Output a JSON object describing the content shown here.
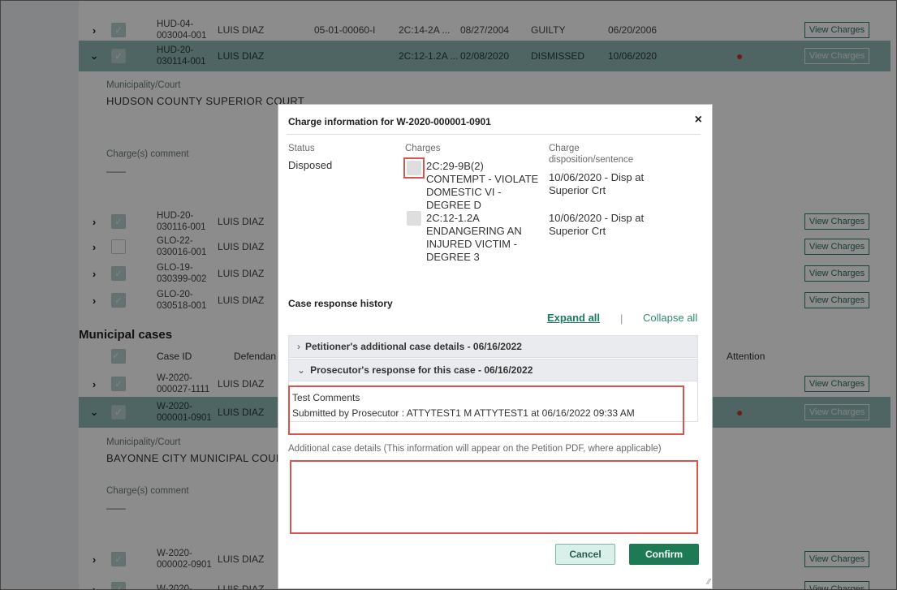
{
  "superior_rows": [
    {
      "expanded": false,
      "case_id": "HUD-04-003004-001",
      "defendant": "LUIS DIAZ",
      "col3": "05-01-00060-I",
      "charges": "2C:14-2A ...",
      "date": "08/27/2004",
      "disposition": "GUILTY",
      "disp_date": "06/20/2006",
      "view": "View Charges"
    },
    {
      "expanded": true,
      "case_id": "HUD-20-030114-001",
      "defendant": "LUIS DIAZ",
      "col3": "",
      "charges": "2C:12-1.2A ...",
      "date": "02/08/2020",
      "disposition": "DISMISSED",
      "disp_date": "10/06/2020",
      "view": "View Charges"
    },
    {
      "expanded": false,
      "case_id": "HUD-20-030116-001",
      "defendant": "LUIS DIAZ",
      "view": "View Charges"
    },
    {
      "expanded": false,
      "case_id": "GLO-22-030016-001",
      "defendant": "LUIS DIAZ",
      "view": "View Charges"
    },
    {
      "expanded": false,
      "case_id": "GLO-19-030399-002",
      "defendant": "LUIS DIAZ",
      "view": "View Charges"
    },
    {
      "expanded": false,
      "case_id": "GLO-20-030518-001",
      "defendant": "LUIS DIAZ",
      "view": "View Charges"
    }
  ],
  "superior_detail": {
    "court_label": "Municipality/Court",
    "court_value": "HUDSON COUNTY SUPERIOR COURT",
    "comment_label": "Charge(s) comment",
    "comment_value": "——"
  },
  "municipal": {
    "title": "Municipal cases",
    "headers": {
      "case_id": "Case ID",
      "defendant": "Defendan",
      "attention": "Attention"
    },
    "rows": [
      {
        "case_id": "W-2020-000027-1111",
        "defendant": "LUIS DIAZ",
        "view": "View Charges"
      },
      {
        "case_id": "W-2020-000001-0901",
        "defendant": "LUIS DIAZ",
        "view": "View Charges"
      },
      {
        "case_id": "W-2020-000002-0901",
        "defendant": "LUIS DIAZ",
        "view": "View Charges"
      },
      {
        "case_id": "W-2020-",
        "defendant": "LUIS DIAZ",
        "view": "View Charges"
      }
    ],
    "detail": {
      "court_label": "Municipality/Court",
      "court_value": "BAYONNE CITY MUNICIPAL COURT",
      "comment_label": "Charge(s) comment",
      "comment_value": "——"
    }
  },
  "modal": {
    "title": "Charge information for W-2020-000001-0901",
    "close": "×",
    "status_label": "Status",
    "status_value": "Disposed",
    "charges_label": "Charges",
    "disp_label_1": "Charge",
    "disp_label_2": "disposition/sentence",
    "charges": [
      {
        "text": "2C:29-9B(2) CONTEMPT - VIOLATE DOMESTIC VI - DEGREE D",
        "disposition": "10/06/2020 - Disp at Superior Crt"
      },
      {
        "text": "2C:12-1.2A ENDANGERING AN INJURED VICTIM - DEGREE 3",
        "disposition": "10/06/2020 - Disp at Superior Crt"
      }
    ],
    "history_label": "Case response history",
    "expand_all": "Expand all",
    "separator": "|",
    "collapse_all": "Collapse all",
    "acc1": "Petitioner's additional case details - 06/16/2022",
    "acc2": "Prosecutor's response for this case - 06/16/2022",
    "comment_line1": "Test Comments",
    "comment_line2": "Submitted by Prosecutor : ATTYTEST1 M ATTYTEST1 at 06/16/2022 09:33 AM",
    "additional_label": "Additional case details (This information will appear on the Petition PDF, where applicable)",
    "textarea_value": "",
    "cancel": "Cancel",
    "confirm": "Confirm"
  }
}
